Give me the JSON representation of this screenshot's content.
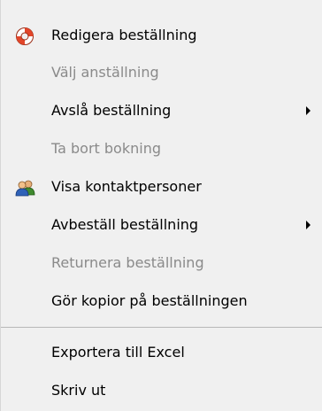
{
  "menu": {
    "items": [
      {
        "label": "Redigera beställning",
        "enabled": true,
        "icon": "lifebuoy-icon",
        "submenu": false
      },
      {
        "label": "Välj anställning",
        "enabled": false,
        "icon": null,
        "submenu": false
      },
      {
        "label": "Avslå beställning",
        "enabled": true,
        "icon": null,
        "submenu": true
      },
      {
        "label": "Ta bort bokning",
        "enabled": false,
        "icon": null,
        "submenu": false
      },
      {
        "label": "Visa kontaktpersoner",
        "enabled": true,
        "icon": "contacts-icon",
        "submenu": false
      },
      {
        "label": "Avbeställ beställning",
        "enabled": true,
        "icon": null,
        "submenu": true
      },
      {
        "label": "Returnera beställning",
        "enabled": false,
        "icon": null,
        "submenu": false
      },
      {
        "label": "Gör kopior på beställningen",
        "enabled": true,
        "icon": null,
        "submenu": false
      },
      {
        "label": "Exportera till Excel",
        "enabled": true,
        "icon": null,
        "submenu": false
      },
      {
        "label": "Skriv ut",
        "enabled": true,
        "icon": null,
        "submenu": false
      }
    ]
  },
  "colors": {
    "background": "#f0f0f0",
    "text_enabled": "#000000",
    "text_disabled": "#8a8a8a",
    "separator": "#b8b8b8"
  }
}
